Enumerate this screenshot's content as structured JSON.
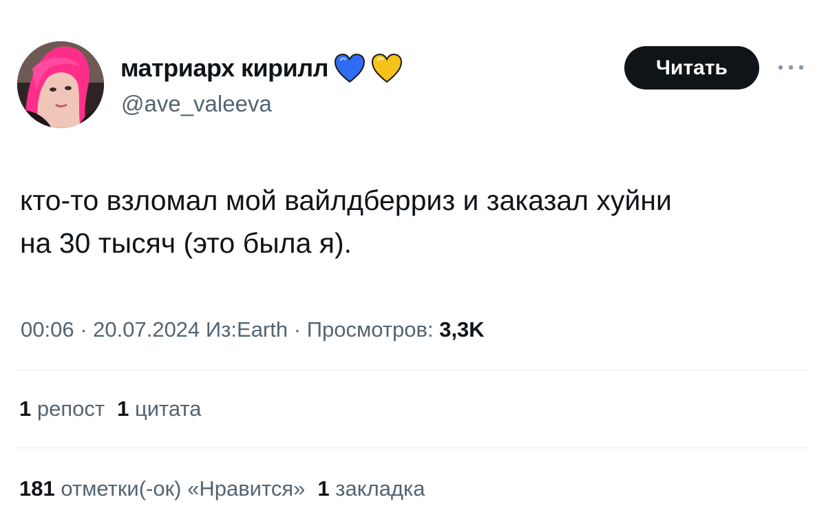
{
  "author": {
    "display_name": "матриарх кирилл",
    "handle": "@ave_valeeva",
    "badges": [
      {
        "icon": "blue-heart-icon",
        "color": "#2f6cf3"
      },
      {
        "icon": "yellow-heart-icon",
        "color": "#f5c21b"
      }
    ]
  },
  "follow_button": {
    "label": "Читать"
  },
  "more_menu": {
    "icon": "more-horizontal-icon"
  },
  "tweet": {
    "lines": [
      "кто-то взломал мой вайлдберриз и заказал хуйни",
      "на 30 тысяч (это была я)."
    ]
  },
  "meta": {
    "time": "00:06",
    "sep1": " · ",
    "date": "20.07.2024",
    "source": " Из:Earth",
    "sep2": " · ",
    "views_label": "Просмотров: ",
    "views_count": "3,3K"
  },
  "stats": {
    "reposts": {
      "count": "1",
      "label": " репост"
    },
    "quotes": {
      "count": "1",
      "label": " цитата"
    },
    "likes": {
      "count": "181",
      "label": " отметки(-ок) «Нравится»"
    },
    "bookmarks": {
      "count": "1",
      "label": " закладка"
    }
  },
  "colors": {
    "text": "#0f1419",
    "secondary": "#536471",
    "button_bg": "#0f1419",
    "divider": "#e6e9ec",
    "avatar_hair": "#ff2e8a"
  }
}
